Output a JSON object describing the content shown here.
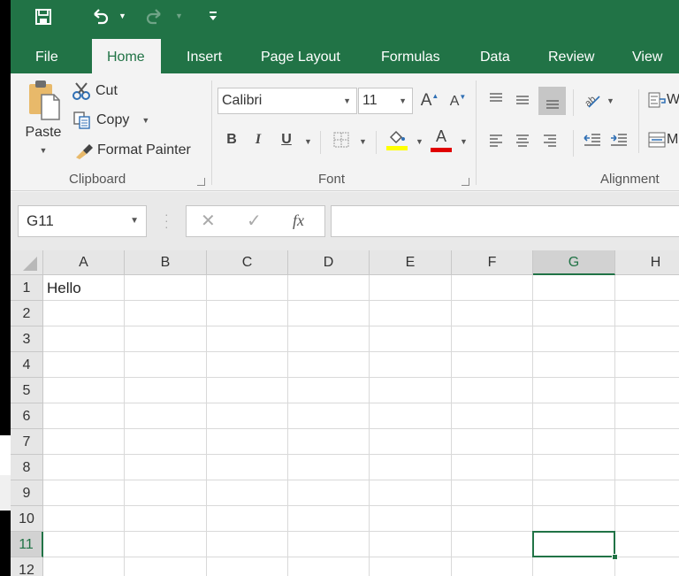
{
  "quick_access": {
    "save_icon": "save-icon",
    "undo_icon": "undo-icon",
    "redo_icon": "redo-icon",
    "customize_icon": "customize-qat-icon"
  },
  "tabs": [
    {
      "label": "File",
      "active": false
    },
    {
      "label": "Home",
      "active": true
    },
    {
      "label": "Insert",
      "active": false
    },
    {
      "label": "Page Layout",
      "active": false
    },
    {
      "label": "Formulas",
      "active": false
    },
    {
      "label": "Data",
      "active": false
    },
    {
      "label": "Review",
      "active": false
    },
    {
      "label": "View",
      "active": false
    }
  ],
  "ribbon": {
    "clipboard": {
      "label": "Clipboard",
      "paste": "Paste",
      "cut": "Cut",
      "copy": "Copy",
      "format_painter": "Format Painter"
    },
    "font": {
      "label": "Font",
      "font_name": "Calibri",
      "font_size": "11",
      "bold": "B",
      "italic": "I",
      "underline": "U",
      "increase_size": "A",
      "decrease_size": "A",
      "fill_color": "#ffff00",
      "font_color": "#e00000"
    },
    "alignment": {
      "label": "Alignment",
      "wrap_text": "W",
      "merge": "M"
    }
  },
  "formula_bar": {
    "name_box": "G11",
    "cancel": "✕",
    "enter": "✓",
    "fx": "fx",
    "value": ""
  },
  "sheet": {
    "columns": [
      "A",
      "B",
      "C",
      "D",
      "E",
      "F",
      "G",
      "H"
    ],
    "rows": [
      "1",
      "2",
      "3",
      "4",
      "5",
      "6",
      "7",
      "8",
      "9",
      "10",
      "11",
      "12"
    ],
    "selected_cell": "G11",
    "selected_column": "G",
    "selected_row": "11",
    "cells": {
      "A1": "Hello"
    }
  },
  "colors": {
    "accent": "#217346"
  }
}
